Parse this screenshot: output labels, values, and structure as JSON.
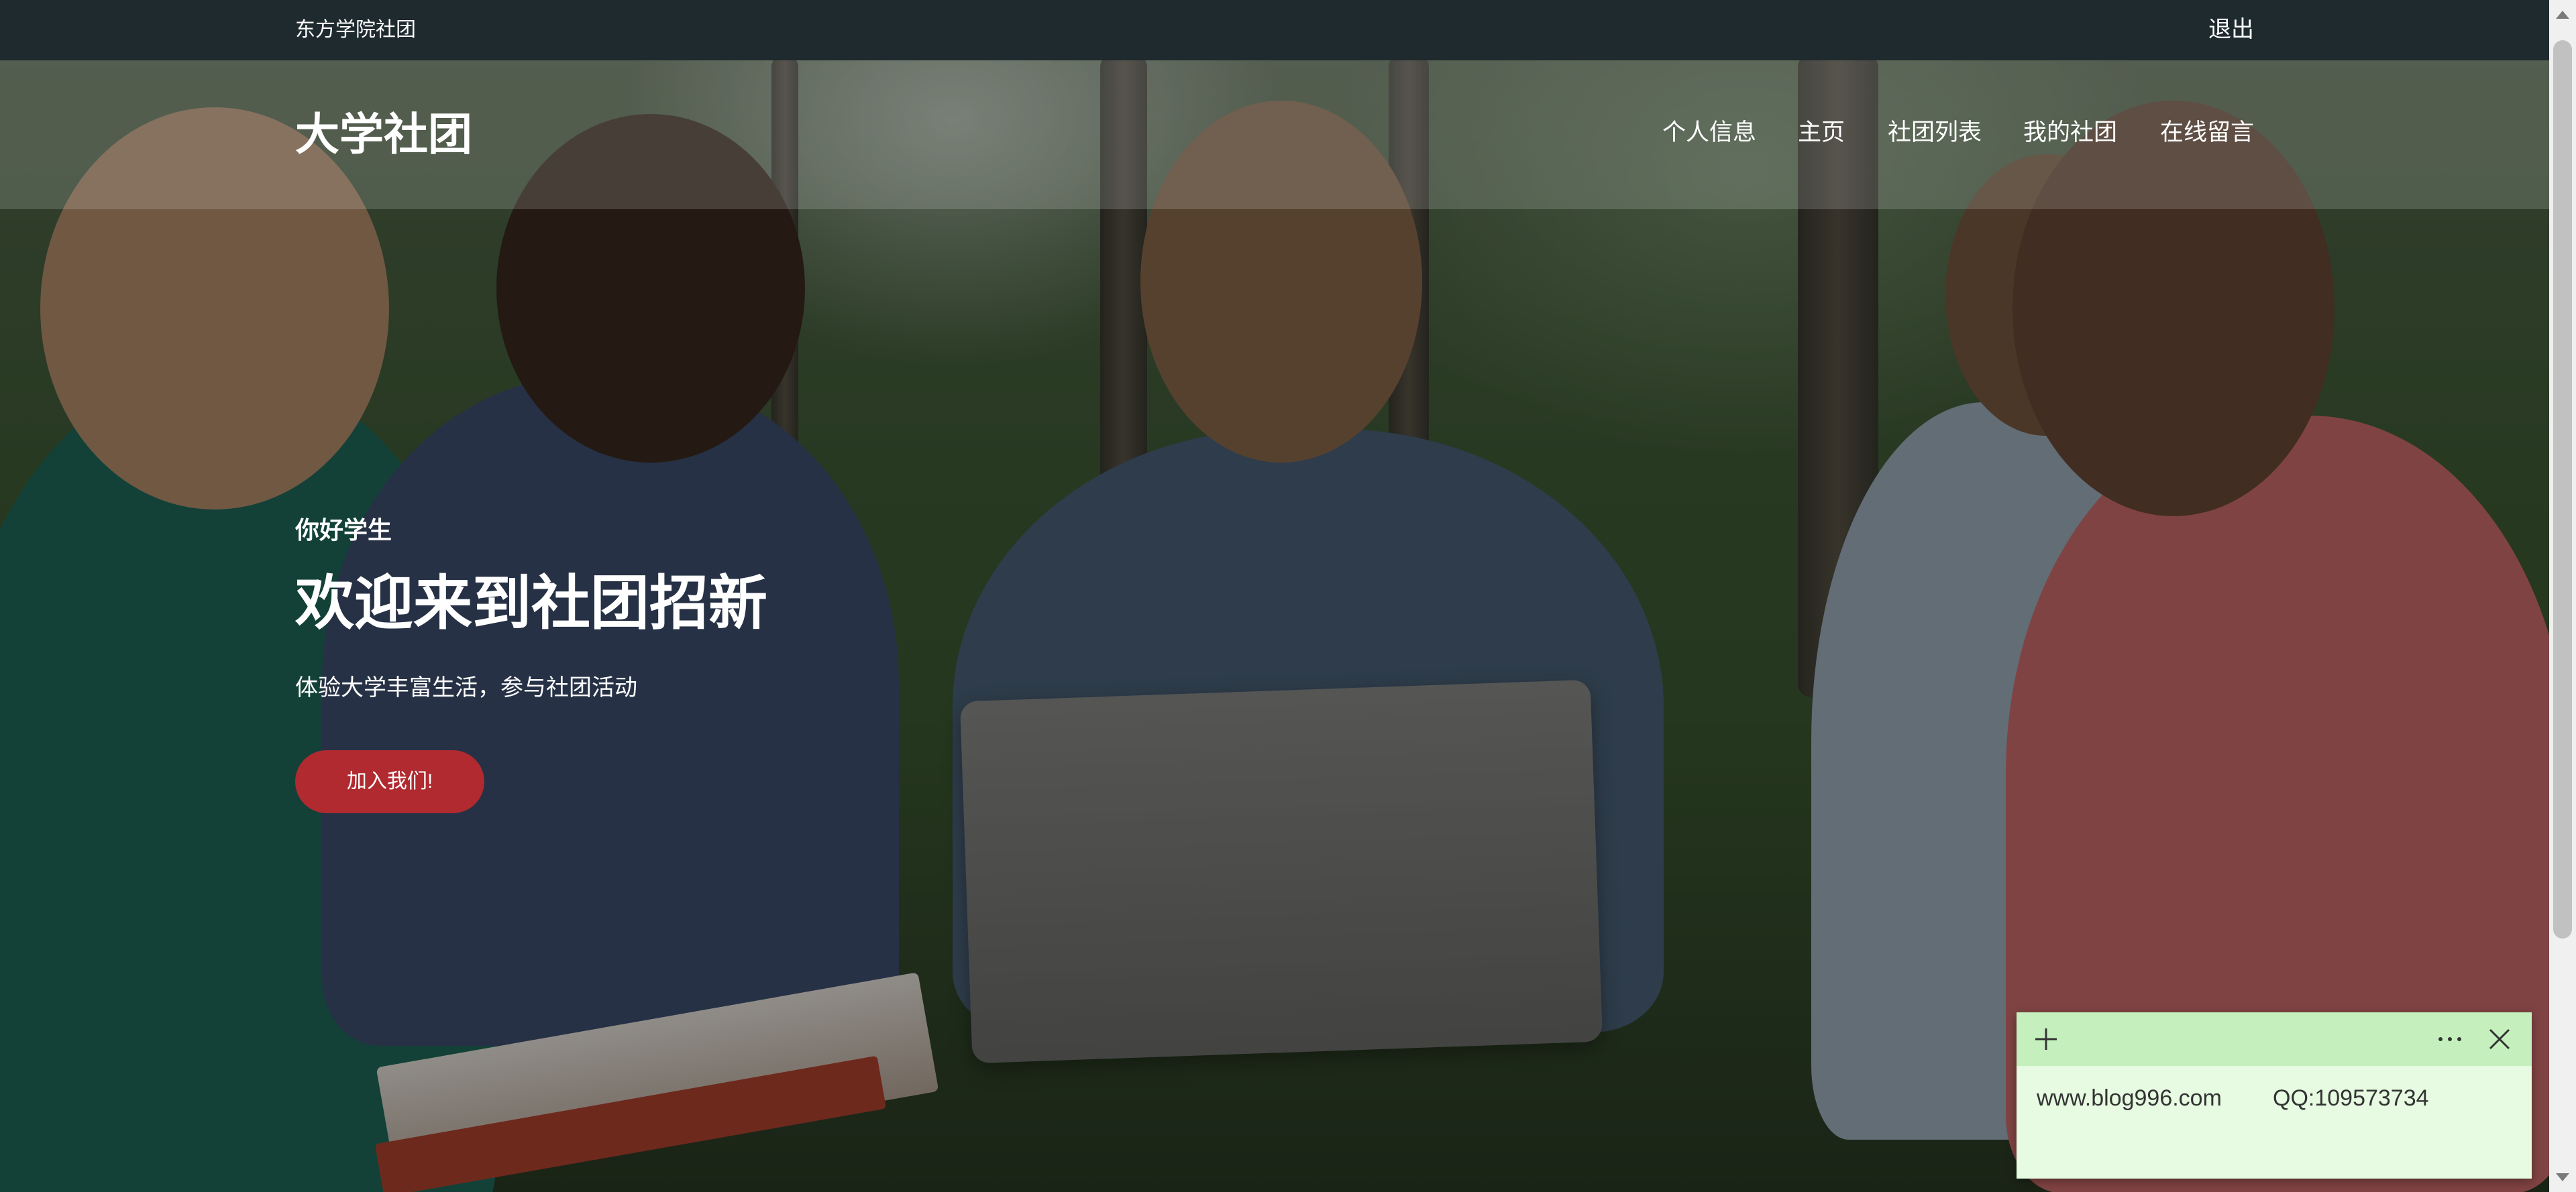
{
  "topbar": {
    "site_name": "东方学院社团",
    "logout_label": "退出"
  },
  "header": {
    "brand": "大学社团",
    "nav": [
      {
        "label": "个人信息"
      },
      {
        "label": "主页"
      },
      {
        "label": "社团列表"
      },
      {
        "label": "我的社团"
      },
      {
        "label": "在线留言"
      }
    ]
  },
  "hero": {
    "greeting": "你好学生",
    "title": "欢迎来到社团招新",
    "subtitle": "体验大学丰富生活，参与社团活动",
    "cta_label": "加入我们!"
  },
  "sticky_note": {
    "lines": [
      "www.blog996.com",
      "QQ:109573734"
    ],
    "add_icon": "plus-icon",
    "more_icon": "more-dots-icon",
    "close_icon": "close-icon"
  },
  "colors": {
    "topbar_bg": "#1f2a2f",
    "cta_bg": "#b02a30",
    "note_bar": "#c5f0bd",
    "note_body": "#e6fbe1"
  }
}
